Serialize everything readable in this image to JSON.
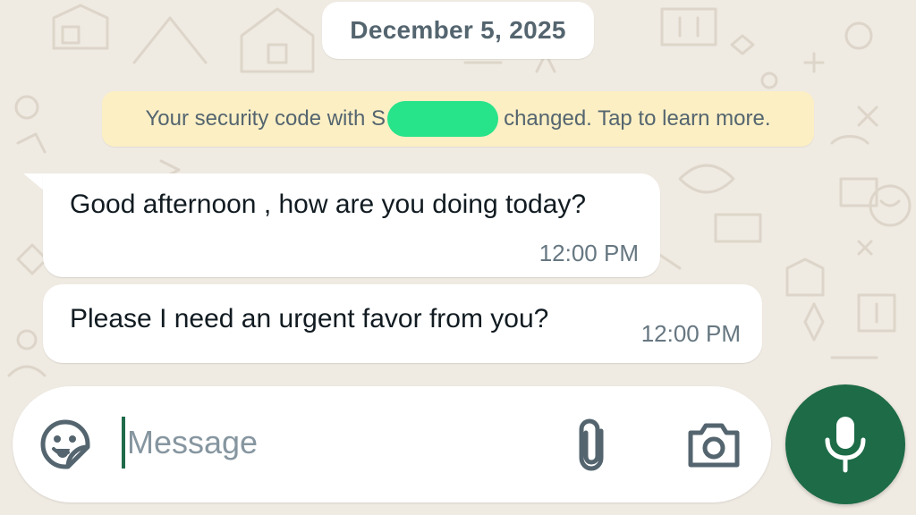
{
  "chat": {
    "date_label": "December 5, 2025",
    "security_notice": {
      "prefix": "Your security code with S",
      "suffix": "changed. Tap to learn more."
    },
    "messages": [
      {
        "text": "Good afternoon , how are you doing today?",
        "time": "12:00 PM",
        "direction": "incoming"
      },
      {
        "text": "Please I need an urgent favor from you?",
        "time": "12:00 PM",
        "direction": "incoming"
      }
    ]
  },
  "composer": {
    "placeholder": "Message",
    "value": "",
    "icons": [
      "sticker-icon",
      "paperclip-icon",
      "camera-icon"
    ],
    "send_button_icon": "microphone-icon"
  },
  "colors": {
    "chat_background": "#efeae2",
    "bubble_incoming": "#ffffff",
    "security_banner": "#fcefc4",
    "redaction_marker": "#27e38a",
    "accent_green": "#1d6b47",
    "text_primary": "#111b21",
    "text_secondary": "#54656f"
  }
}
